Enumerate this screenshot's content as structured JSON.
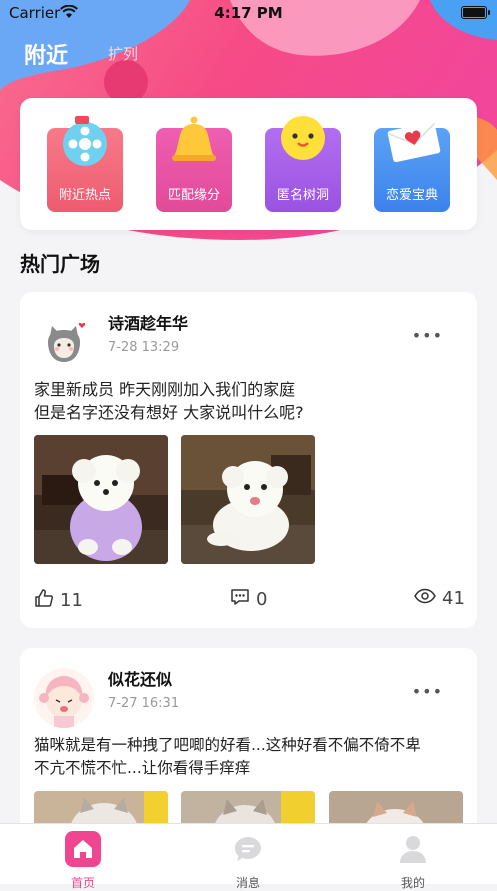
{
  "status_bar": {
    "carrier": "Carrier",
    "time": "4:17 PM"
  },
  "top_nav": {
    "active_tab": "附近",
    "inactive_tab": "扩列"
  },
  "categories": [
    {
      "label": "附近热点",
      "icon": "film-reel-icon",
      "color": "#f0647a"
    },
    {
      "label": "匹配缘分",
      "icon": "bell-icon",
      "color": "#e64fa0"
    },
    {
      "label": "匿名树洞",
      "icon": "smiley-face-icon",
      "color": "#a35ae6"
    },
    {
      "label": "恋爱宝典",
      "icon": "love-letter-icon",
      "color": "#4a8df2"
    }
  ],
  "section": {
    "title": "热门广场"
  },
  "posts": [
    {
      "username": "诗酒趁年华",
      "time": "7-28 13:29",
      "more": "•••",
      "content_lines": [
        "家里新成员 昨天刚刚加入我们的家庭",
        "但是名字还没有想好 大家说叫什么呢?"
      ],
      "likes": "11",
      "comments": "0",
      "views": "41"
    },
    {
      "username": "似花还似",
      "time": "7-27 16:31",
      "more": "•••",
      "content_lines": [
        "猫咪就是有一种拽了吧唧的好看...这种好看不偏不倚不卑",
        "不亢不慌不忙...让你看得手痒痒"
      ]
    }
  ],
  "tab_bar": {
    "items": [
      {
        "label": "首页",
        "icon": "home-icon",
        "active": true
      },
      {
        "label": "消息",
        "icon": "message-icon",
        "active": false
      },
      {
        "label": "我的",
        "icon": "profile-icon",
        "active": false
      }
    ],
    "active_color": "#f0468f",
    "inactive_color": "#555555"
  }
}
